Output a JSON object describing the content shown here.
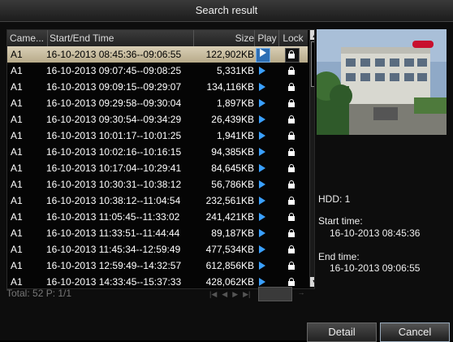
{
  "window": {
    "title": "Search result"
  },
  "table": {
    "headers": {
      "camera": "Came...",
      "time": "Start/End Time",
      "size": "Size",
      "play": "Play",
      "lock": "Lock"
    },
    "rows": [
      {
        "camera": "A1",
        "time": "16-10-2013 08:45:36--09:06:55",
        "size": "122,902KB"
      },
      {
        "camera": "A1",
        "time": "16-10-2013 09:07:45--09:08:25",
        "size": "5,331KB"
      },
      {
        "camera": "A1",
        "time": "16-10-2013 09:09:15--09:29:07",
        "size": "134,116KB"
      },
      {
        "camera": "A1",
        "time": "16-10-2013 09:29:58--09:30:04",
        "size": "1,897KB"
      },
      {
        "camera": "A1",
        "time": "16-10-2013 09:30:54--09:34:29",
        "size": "26,439KB"
      },
      {
        "camera": "A1",
        "time": "16-10-2013 10:01:17--10:01:25",
        "size": "1,941KB"
      },
      {
        "camera": "A1",
        "time": "16-10-2013 10:02:16--10:16:15",
        "size": "94,385KB"
      },
      {
        "camera": "A1",
        "time": "16-10-2013 10:17:04--10:29:41",
        "size": "84,645KB"
      },
      {
        "camera": "A1",
        "time": "16-10-2013 10:30:31--10:38:12",
        "size": "56,786KB"
      },
      {
        "camera": "A1",
        "time": "16-10-2013 10:38:12--11:04:54",
        "size": "232,561KB"
      },
      {
        "camera": "A1",
        "time": "16-10-2013 11:05:45--11:33:02",
        "size": "241,421KB"
      },
      {
        "camera": "A1",
        "time": "16-10-2013 11:33:51--11:44:44",
        "size": "89,187KB"
      },
      {
        "camera": "A1",
        "time": "16-10-2013 11:45:34--12:59:49",
        "size": "477,534KB"
      },
      {
        "camera": "A1",
        "time": "16-10-2013 12:59:49--14:32:57",
        "size": "612,856KB"
      },
      {
        "camera": "A1",
        "time": "16-10-2013 14:33:45--15:37:33",
        "size": "428,062KB"
      }
    ],
    "selected_index": 0
  },
  "footer": {
    "summary": "Total: 52  P: 1/1"
  },
  "preview": {
    "hdd": "HDD: 1",
    "start_label": "Start time:",
    "start_value": "16-10-2013 08:45:36",
    "end_label": "End time:",
    "end_value": "16-10-2013 09:06:55"
  },
  "buttons": {
    "detail": "Detail",
    "cancel": "Cancel"
  },
  "colors": {
    "accent": "#3aa0ff",
    "selected_row": "#c9bd9c"
  }
}
